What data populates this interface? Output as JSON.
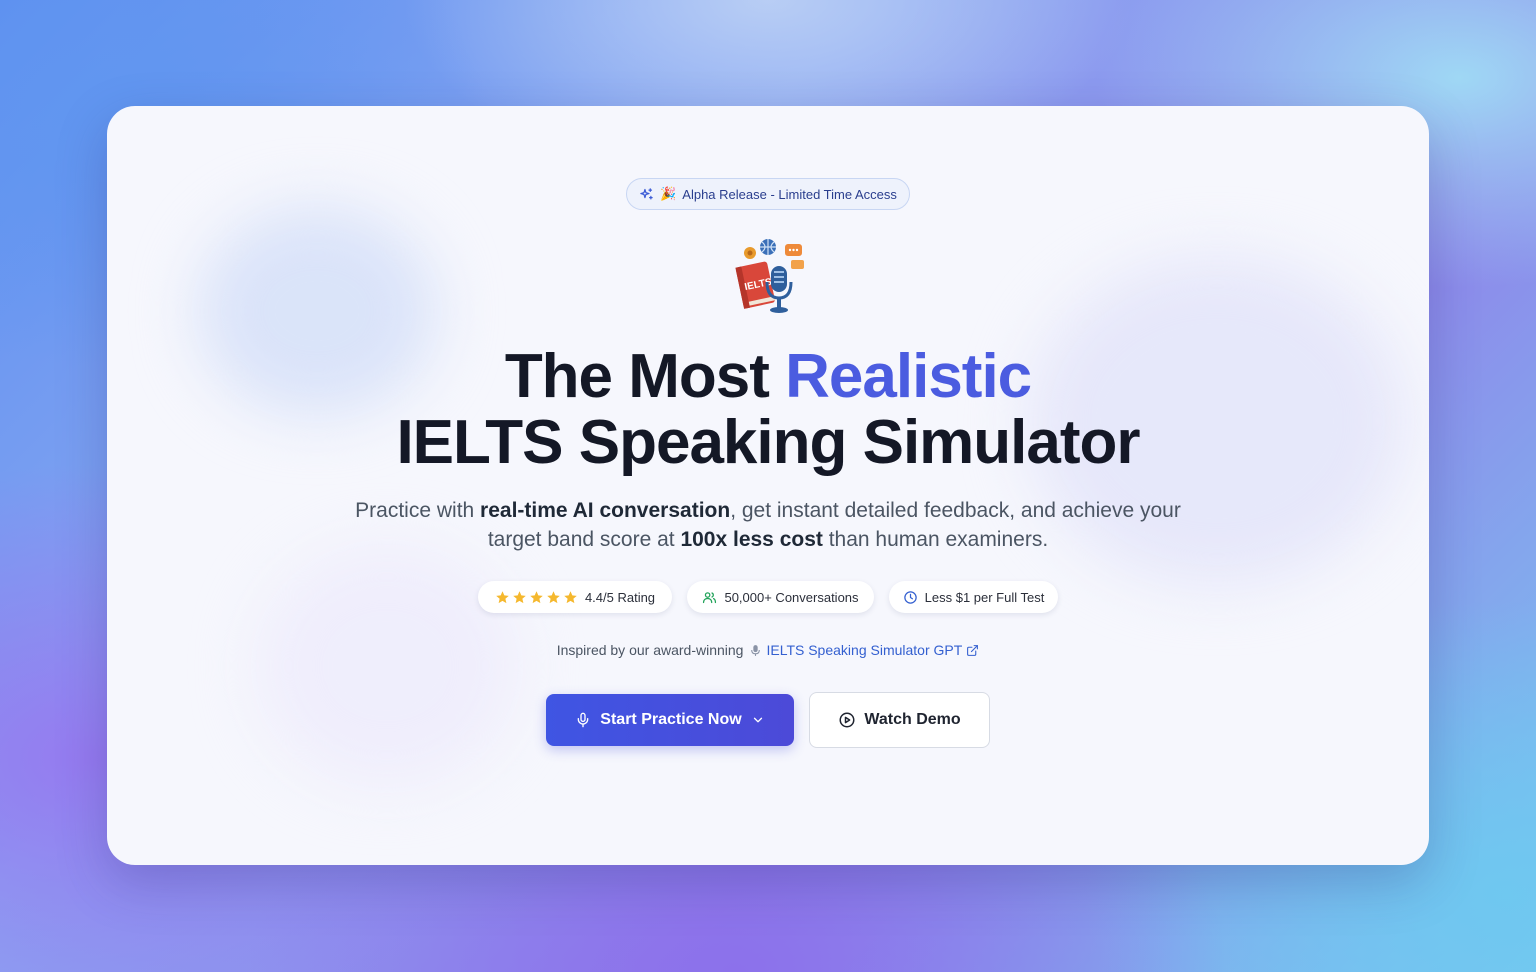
{
  "badge": {
    "icon": "sparkles-icon",
    "emoji": "🎉",
    "text": "Alpha Release - Limited Time Access"
  },
  "hero": {
    "icon": "ielts-book-microphone-icon",
    "icon_text": "IELTS",
    "title_part1": "The Most ",
    "title_accent": "Realistic",
    "title_line2": "IELTS Speaking Simulator",
    "accent_color": "#4b5ce0"
  },
  "subtitle": {
    "part1": "Practice with ",
    "bold1": "real-time AI conversation",
    "part2": ", get instant detailed feedback, and achieve your target band score at ",
    "bold2": "100x less cost",
    "part3": " than human examiners."
  },
  "stats": {
    "rating": {
      "stars": 5,
      "text": "4.4/5 Rating",
      "star_color": "#f5b82e"
    },
    "conversations": {
      "icon": "users-icon",
      "text": "50,000+ Conversations",
      "icon_color": "#22a35a"
    },
    "cost": {
      "icon": "clock-icon",
      "text": "Less $1 per Full Test",
      "icon_color": "#3460d0"
    }
  },
  "inspired": {
    "text": "Inspired by our award-winning",
    "link_icon": "microphone-emoji-icon",
    "link_text": "IELTS Speaking Simulator GPT",
    "external_icon": "external-link-icon"
  },
  "actions": {
    "primary_label": "Start Practice Now",
    "primary_icon": "microphone-icon",
    "primary_chevron": "chevron-down-icon",
    "secondary_label": "Watch Demo",
    "secondary_icon": "play-circle-icon"
  }
}
